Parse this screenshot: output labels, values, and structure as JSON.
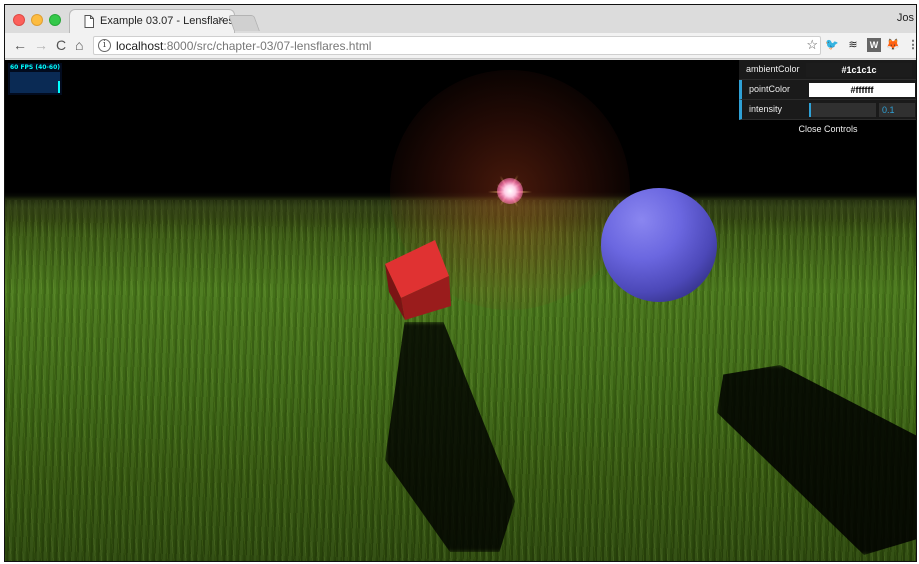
{
  "browser": {
    "tab_title": "Example 03.07 - Lensflarest",
    "tab_close": "×",
    "profile_name": "Jos",
    "url_host": "localhost",
    "url_path": ":8000/src/chapter-03/07-lensflares.html",
    "nav": {
      "back": "←",
      "forward": "→",
      "reload": "C",
      "home": "⌂"
    },
    "info_glyph": "i",
    "star_glyph": "☆",
    "extensions": {
      "twitter": "🐦",
      "stack": "≋",
      "w": "W",
      "fox": "🦊",
      "menu": "⋮"
    }
  },
  "stats": {
    "label": "60 FPS (40-60)",
    "fps_level": 0.57
  },
  "controls": {
    "ambient_label": "ambientColor",
    "ambient_value": "#1c1c1c",
    "point_label": "pointColor",
    "point_value": "#ffffff",
    "intensity_label": "intensity",
    "intensity_value": "0.1",
    "intensity_fraction": 0.02,
    "close_label": "Close Controls"
  },
  "scene": {
    "cube_color": "#d62828",
    "sphere_color": "#6b67e0",
    "flare_color": "#ff6aa8"
  }
}
